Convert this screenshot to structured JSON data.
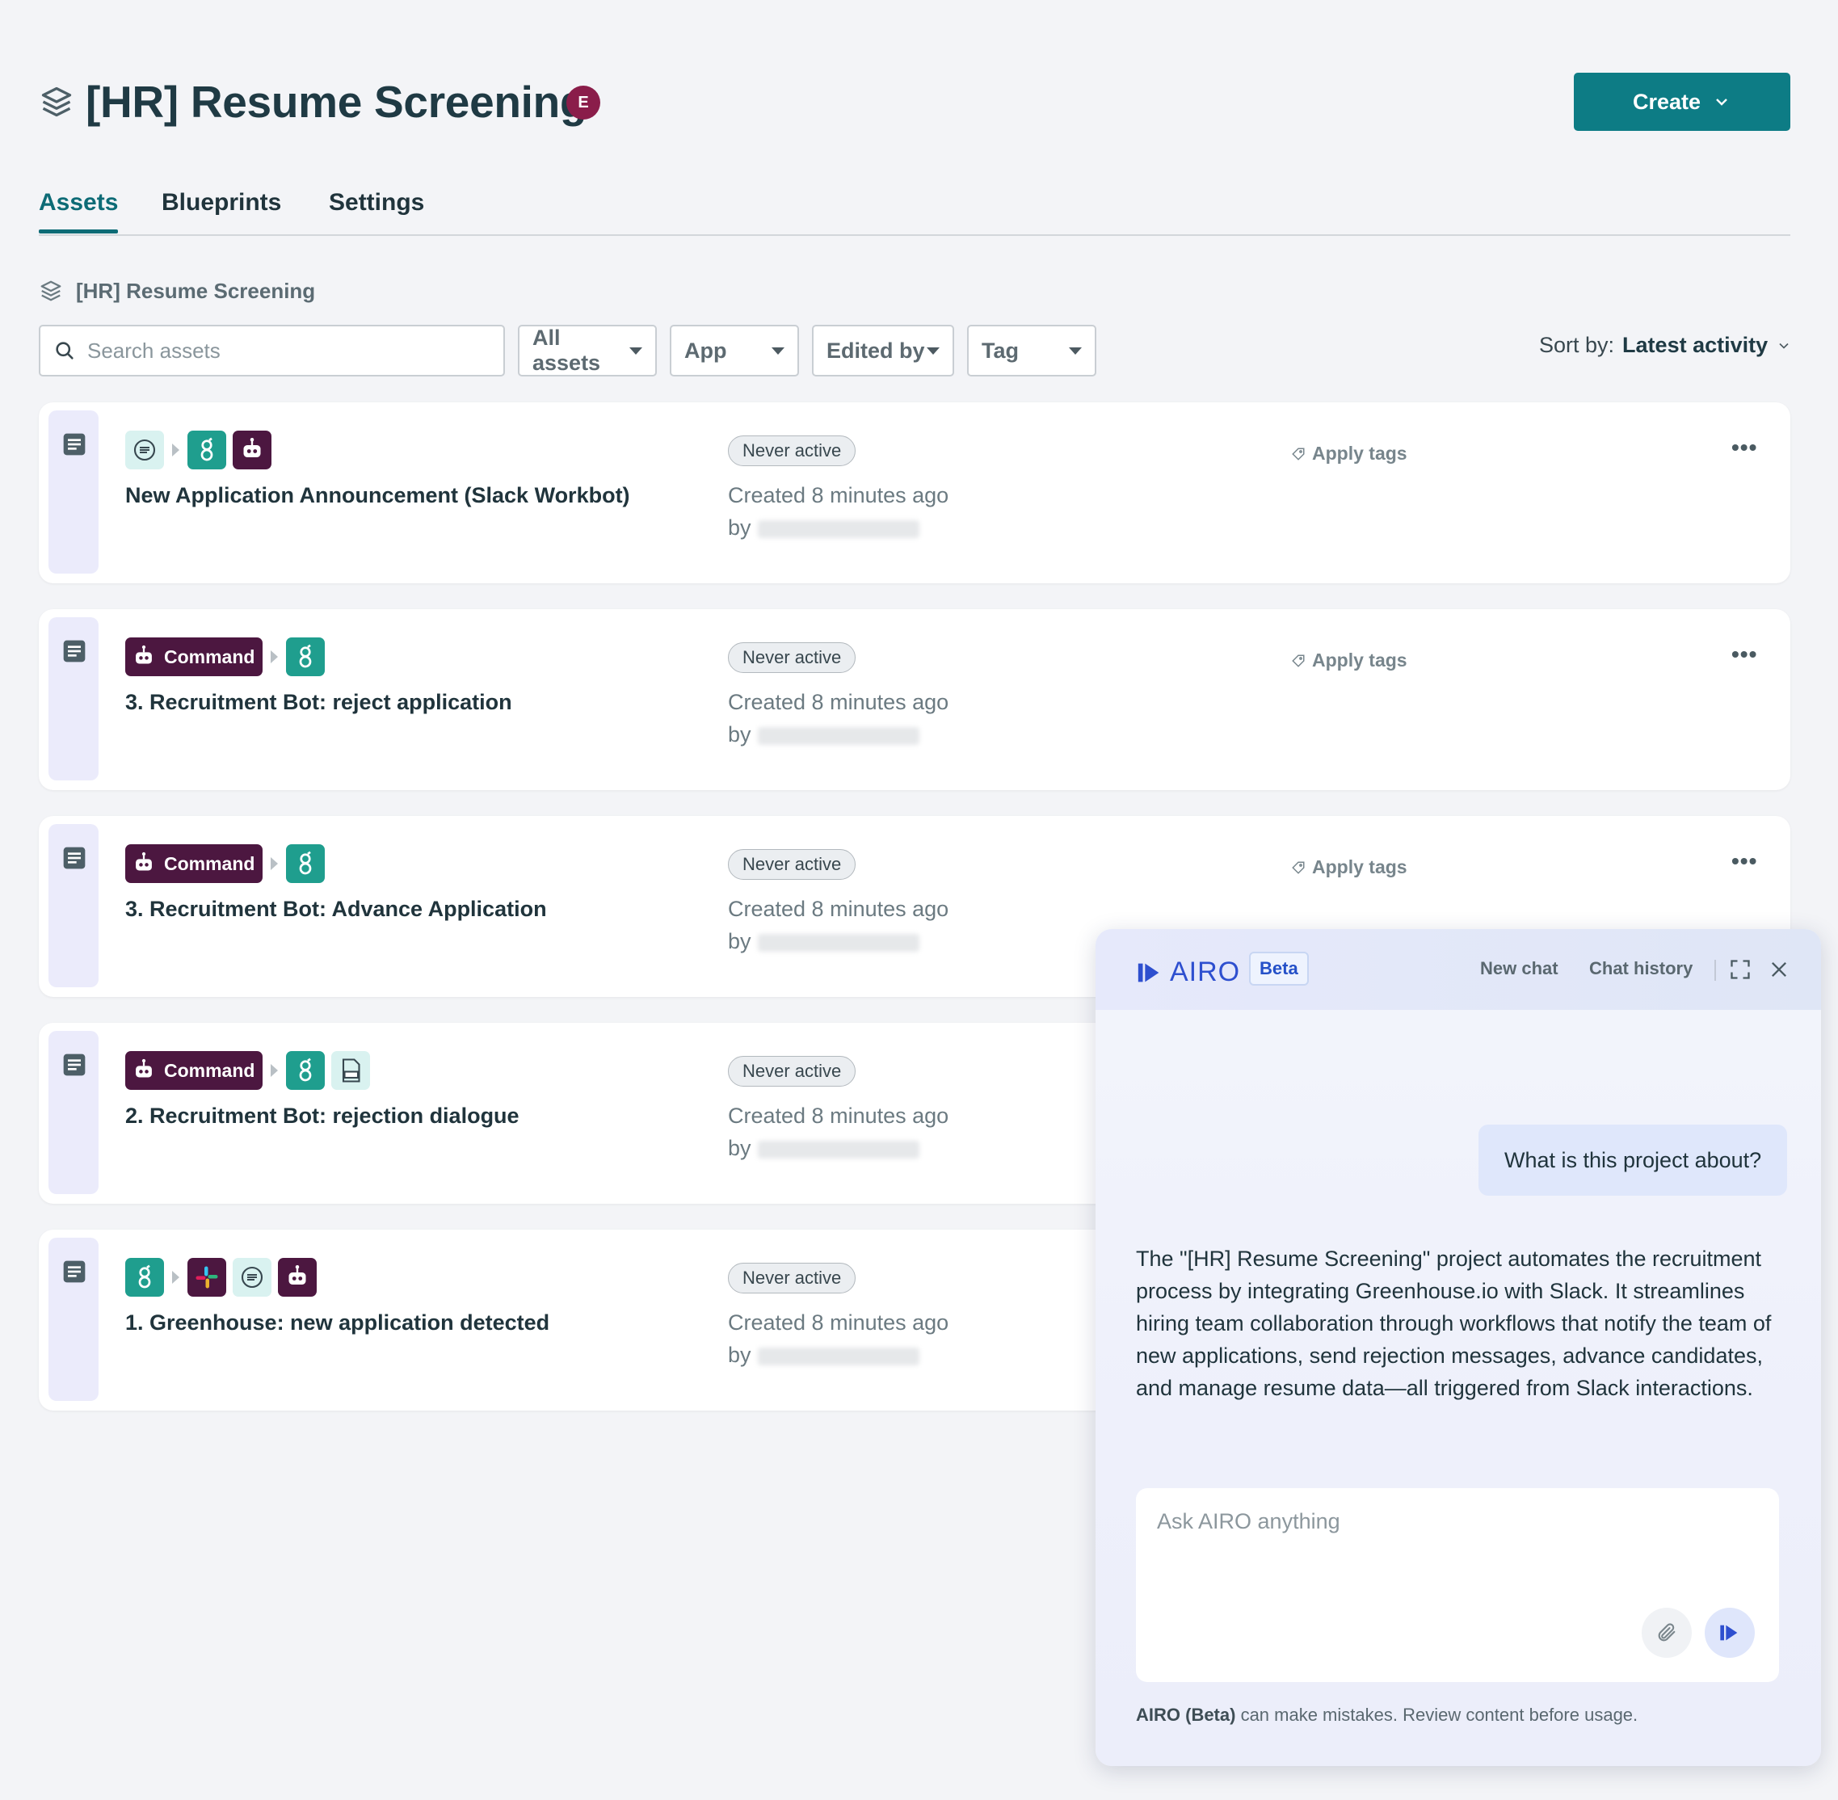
{
  "project": {
    "title": "[HR] Resume Screening",
    "owner_initial": "E"
  },
  "create_button": "Create",
  "tabs": [
    "Assets",
    "Blueprints",
    "Settings"
  ],
  "breadcrumb": "[HR] Resume Screening",
  "search": {
    "placeholder": "Search assets",
    "value": ""
  },
  "filters": [
    "All assets",
    "App",
    "Edited by",
    "Tag"
  ],
  "sort": {
    "label": "Sort by:",
    "value": "Latest activity"
  },
  "command_label": "Command",
  "assets": [
    {
      "title": "New Application Announcement (Slack Workbot)",
      "status": "Never active",
      "created": "Created 8 minutes ago",
      "by": "by",
      "tags": "Apply tags",
      "more": "•••"
    },
    {
      "title": "3. Recruitment Bot: reject application",
      "status": "Never active",
      "created": "Created 8 minutes ago",
      "by": "by",
      "tags": "Apply tags",
      "more": "•••"
    },
    {
      "title": "3. Recruitment Bot: Advance Application",
      "status": "Never active",
      "created": "Created 8 minutes ago",
      "by": "by",
      "tags": "Apply tags",
      "more": "•••"
    },
    {
      "title": "2. Recruitment Bot: rejection dialogue",
      "status": "Never active",
      "created": "Created 8 minutes ago",
      "by": "by"
    },
    {
      "title": "1. Greenhouse: new application detected",
      "status": "Never active",
      "created": "Created 8 minutes ago",
      "by": "by"
    }
  ],
  "airo": {
    "name": "AIRO",
    "beta": "Beta",
    "new_chat": "New chat",
    "chat_history": "Chat history",
    "user_message": "What is this project about?",
    "bot_message": "The \"[HR] Resume Screening\" project automates the recruitment process by integrating Greenhouse.io with Slack. It streamlines hiring team collaboration through workflows that notify the team of new applications, send rejection messages, advance candidates, and manage resume data—all triggered from Slack interactions.",
    "input_placeholder": "Ask AIRO anything",
    "disclaimer_bold": "AIRO (Beta)",
    "disclaimer_rest": " can make mistakes. Review content before usage."
  },
  "colors": {
    "accent": "#0d7c85",
    "workbot": "#4c1740",
    "greenhouse": "#1f9e8e",
    "airo_blue": "#2e4fcf",
    "owner_badge": "#8a1d4a"
  }
}
